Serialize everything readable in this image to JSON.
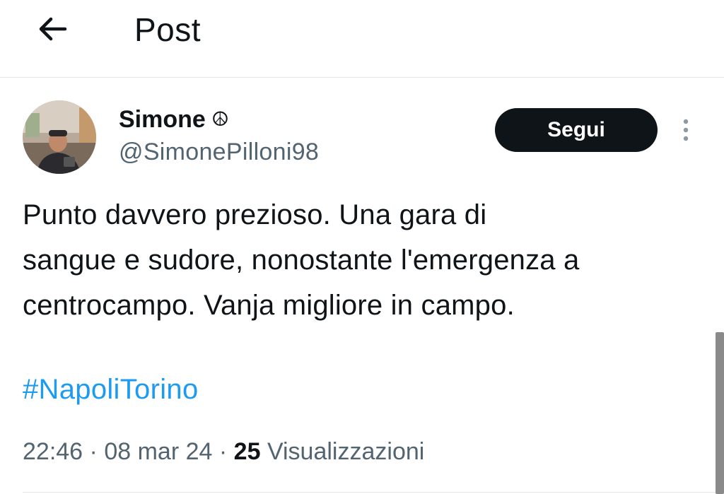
{
  "header": {
    "back_icon": "arrow-left-icon",
    "title": "Post"
  },
  "post": {
    "author": {
      "display_name": "Simone",
      "name_emoji": "☮",
      "handle": "@SimonePilloni98",
      "avatar": "profile-photo"
    },
    "follow_label": "Segui",
    "more_icon": "more-vertical-icon",
    "text_lines": [
      "Punto davvero prezioso. Una gara di",
      "sangue e sudore, nonostante l'emergenza a",
      "centrocampo. Vanja migliore in campo."
    ],
    "hashtag": "#NapoliTorino",
    "time": "22:46",
    "date": "08 mar 24",
    "separator": "·",
    "views_count": "25",
    "views_label": "Visualizzazioni"
  },
  "colors": {
    "text": "#0f1419",
    "secondary": "#536471",
    "link": "#1d9bf0",
    "button_bg": "#0f1419",
    "divider": "#e4e6e8"
  }
}
